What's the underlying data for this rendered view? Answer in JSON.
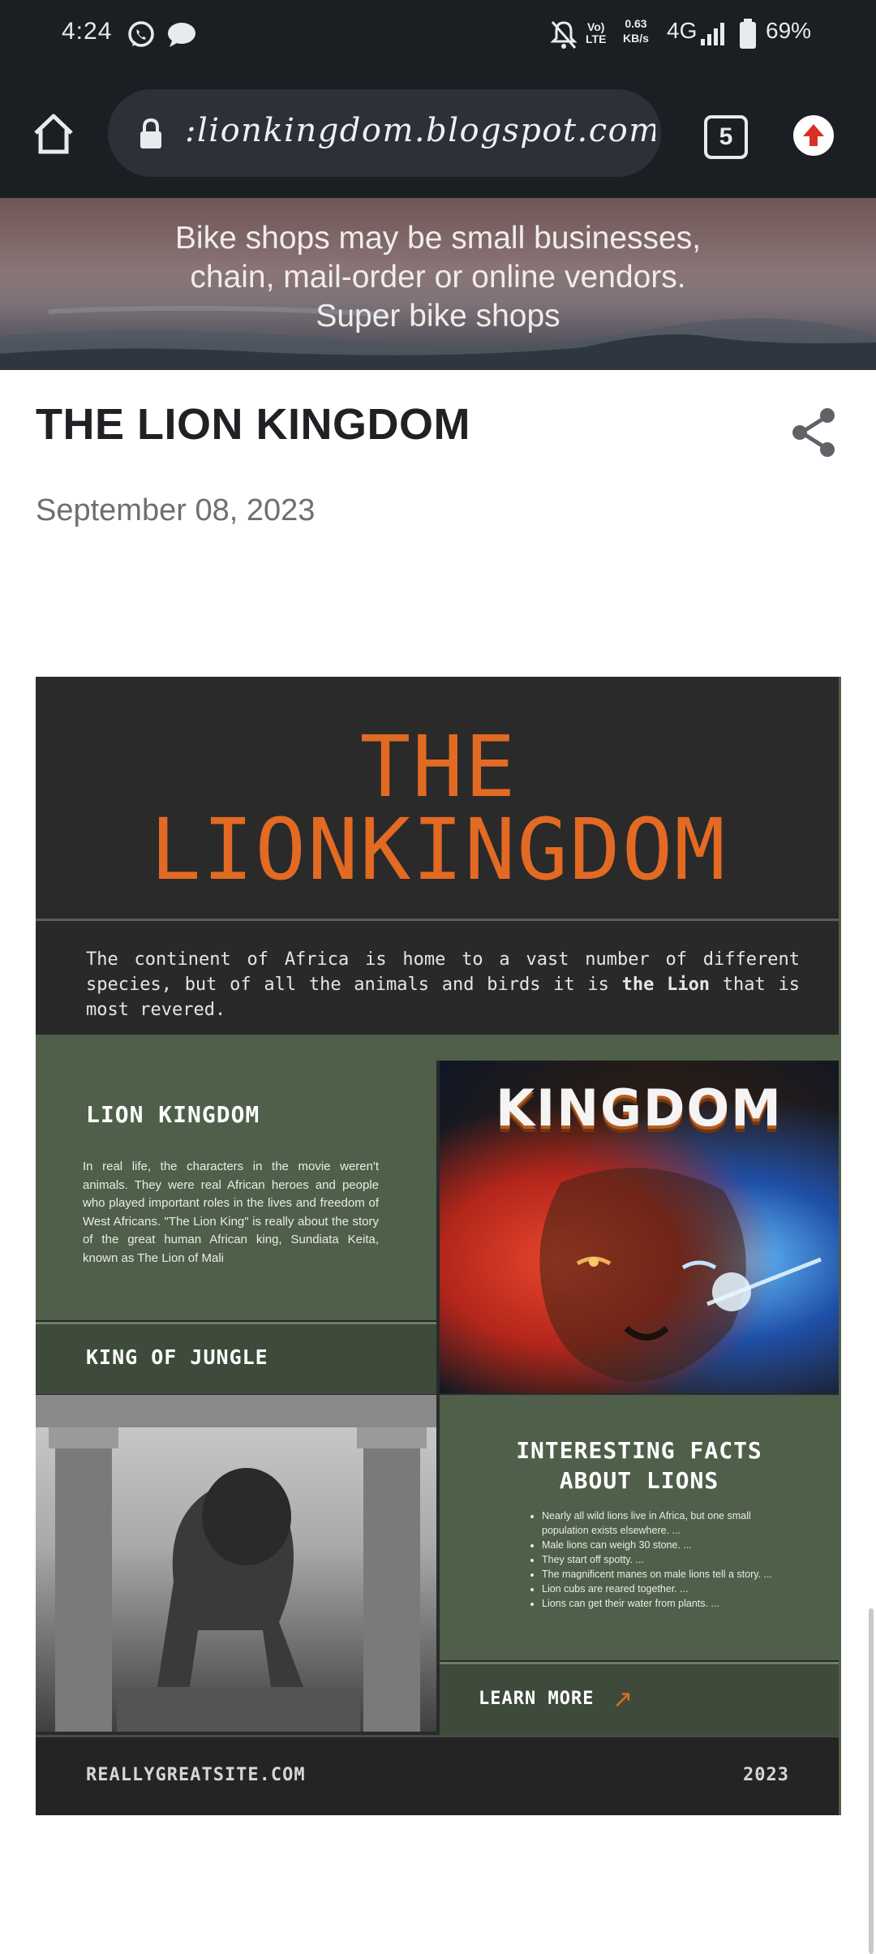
{
  "status_bar": {
    "time": "4:24",
    "network_speed": "0.63\nKB/s",
    "network_type": "4G",
    "volte": "Vo)\nLTE",
    "battery": "69%",
    "icons": [
      "whatsapp-icon",
      "chat-bubble-icon",
      "mute-notifications-icon",
      "signal-icon",
      "battery-icon"
    ]
  },
  "browser": {
    "url": ":lionkingdom.blogspot.com",
    "tab_count": "5",
    "icons": [
      "home-icon",
      "lock-icon",
      "tabs-icon",
      "update-menu-icon"
    ]
  },
  "banner": {
    "tagline_lines": [
      "Bike shops may be small businesses,",
      "chain, mail-order or online vendors.",
      "Super bike shops"
    ]
  },
  "post": {
    "title": "THE LION KINGDOM",
    "date": "September 08, 2023"
  },
  "poster": {
    "title_line1": "THE",
    "title_line2": "LIONKINGDOM",
    "intro_prefix": "The continent of Africa is home to a vast number of different species, but of all the animals and birds it is ",
    "intro_bold": "the Lion",
    "intro_suffix": " that is most revered.",
    "lion_kingdom_heading": "LION KINGDOM",
    "lion_kingdom_body": "In real life, the characters in the movie weren't animals. They were real African heroes and people who played important roles in the lives and freedom of West Africans. \"The Lion King\" is really about the story of the great human African king, Sundiata Keita, known as The Lion of Mali",
    "king_of_jungle": "KING OF JUNGLE",
    "image_title_word": "KINGDOM",
    "facts_heading_line1": "INTERESTING FACTS",
    "facts_heading_line2": "ABOUT LIONS",
    "facts": [
      "Nearly all wild lions live in Africa, but one small population exists elsewhere. ...",
      "Male lions can weigh 30 stone. ...",
      "They start off spotty. ...",
      "The magnificent manes on male lions tell a story. ...",
      "Lion cubs are reared together. ...",
      "Lions can get their water from plants. ..."
    ],
    "learn_more": "LEARN MORE",
    "learn_more_arrow": "↗",
    "site": "REALLYGREATSITE.COM",
    "year": "2023",
    "colors": {
      "accent": "#e36a23",
      "green": "#4f5f49",
      "dark": "#2a2a2a"
    }
  }
}
